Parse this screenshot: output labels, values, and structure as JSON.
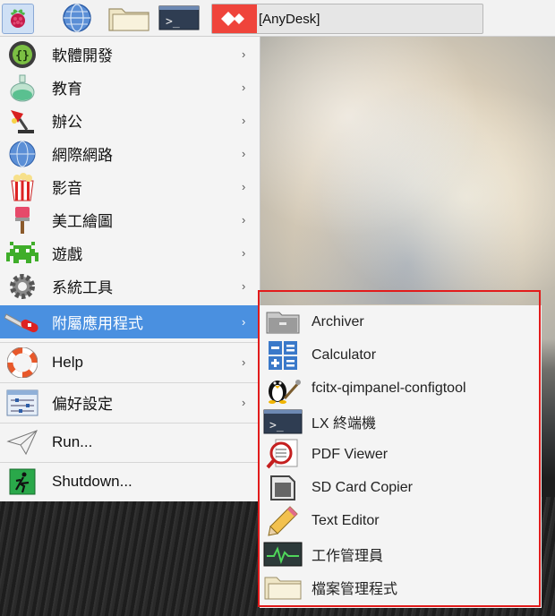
{
  "taskbar": {
    "launchers": [
      {
        "icon": "raspberry-menu-icon"
      },
      {
        "icon": "globe-browser-icon"
      },
      {
        "icon": "folder-icon"
      },
      {
        "icon": "terminal-icon"
      }
    ],
    "task": {
      "label": "[AnyDesk]",
      "icon": "anydesk-icon"
    }
  },
  "menu": {
    "items": [
      {
        "label": "軟體開發",
        "icon": "programming-braces-icon",
        "arrow": "›"
      },
      {
        "label": "教育",
        "icon": "flask-icon",
        "arrow": "›"
      },
      {
        "label": "辦公",
        "icon": "office-lamp-icon",
        "arrow": "›"
      },
      {
        "label": "網際網路",
        "icon": "globe-icon",
        "arrow": "›"
      },
      {
        "label": "影音",
        "icon": "popcorn-icon",
        "arrow": "›"
      },
      {
        "label": "美工繪圖",
        "icon": "paintbrush-icon",
        "arrow": "›"
      },
      {
        "label": "遊戲",
        "icon": "space-invader-icon",
        "arrow": "›"
      },
      {
        "label": "系統工具",
        "icon": "gear-icon",
        "arrow": "›"
      },
      {
        "label": "附屬應用程式",
        "icon": "swiss-knife-icon",
        "arrow": "›",
        "active": true
      }
    ],
    "items2": [
      {
        "label": "Help",
        "icon": "lifebuoy-icon",
        "arrow": "›"
      },
      {
        "label": "偏好設定",
        "icon": "sliders-icon",
        "arrow": "›"
      },
      {
        "label": "Run...",
        "icon": "paper-plane-icon"
      },
      {
        "label": "Shutdown...",
        "icon": "exit-running-man-icon"
      }
    ]
  },
  "submenu": {
    "items": [
      {
        "label": "Archiver",
        "icon": "archive-box-icon"
      },
      {
        "label": "Calculator",
        "icon": "calculator-icon"
      },
      {
        "label": "fcitx-qimpanel-configtool",
        "icon": "penguin-icon"
      },
      {
        "label": "LX 終端機",
        "icon": "terminal-icon"
      },
      {
        "label": "PDF Viewer",
        "icon": "magnifier-document-icon"
      },
      {
        "label": "SD Card Copier",
        "icon": "sd-card-icon"
      },
      {
        "label": "Text Editor",
        "icon": "pencil-icon"
      },
      {
        "label": "工作管理員",
        "icon": "task-monitor-icon"
      },
      {
        "label": "檔案管理程式",
        "icon": "folder-icon"
      }
    ]
  },
  "colors": {
    "accent": "#4a90e0",
    "highlight_box": "#e21b1b"
  }
}
